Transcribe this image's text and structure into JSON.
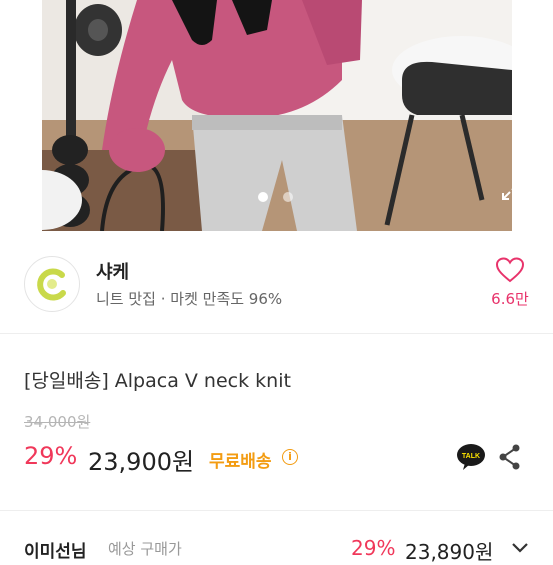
{
  "product_image": {
    "indicator_count": 2,
    "active_index": 0
  },
  "seller": {
    "name": "샤케",
    "subtitle": "니트 맛집 · 마켓 만족도 96%",
    "likes": "6.6만",
    "logo_color": "#c9d94a"
  },
  "product": {
    "title": "[당일배송] Alpaca V neck knit",
    "original_price": "34,000원",
    "discount_rate": "29%",
    "sale_price": "23,900원",
    "free_shipping": "무료배송",
    "info_icon": "i"
  },
  "member_price": {
    "label": "이미선님",
    "sub": "예상 구매가",
    "discount_rate": "29%",
    "price": "23,890원"
  },
  "colors": {
    "accent_pink": "#f0385a",
    "heart": "#e8336b",
    "shipping_orange": "#f39c12",
    "talk_bubble": "#1a1a1a",
    "talk_text": "#fee500"
  },
  "icons": [
    "expand-icon",
    "heart-icon",
    "info-icon",
    "kakaotalk-icon",
    "share-icon",
    "chevron-down-icon"
  ]
}
